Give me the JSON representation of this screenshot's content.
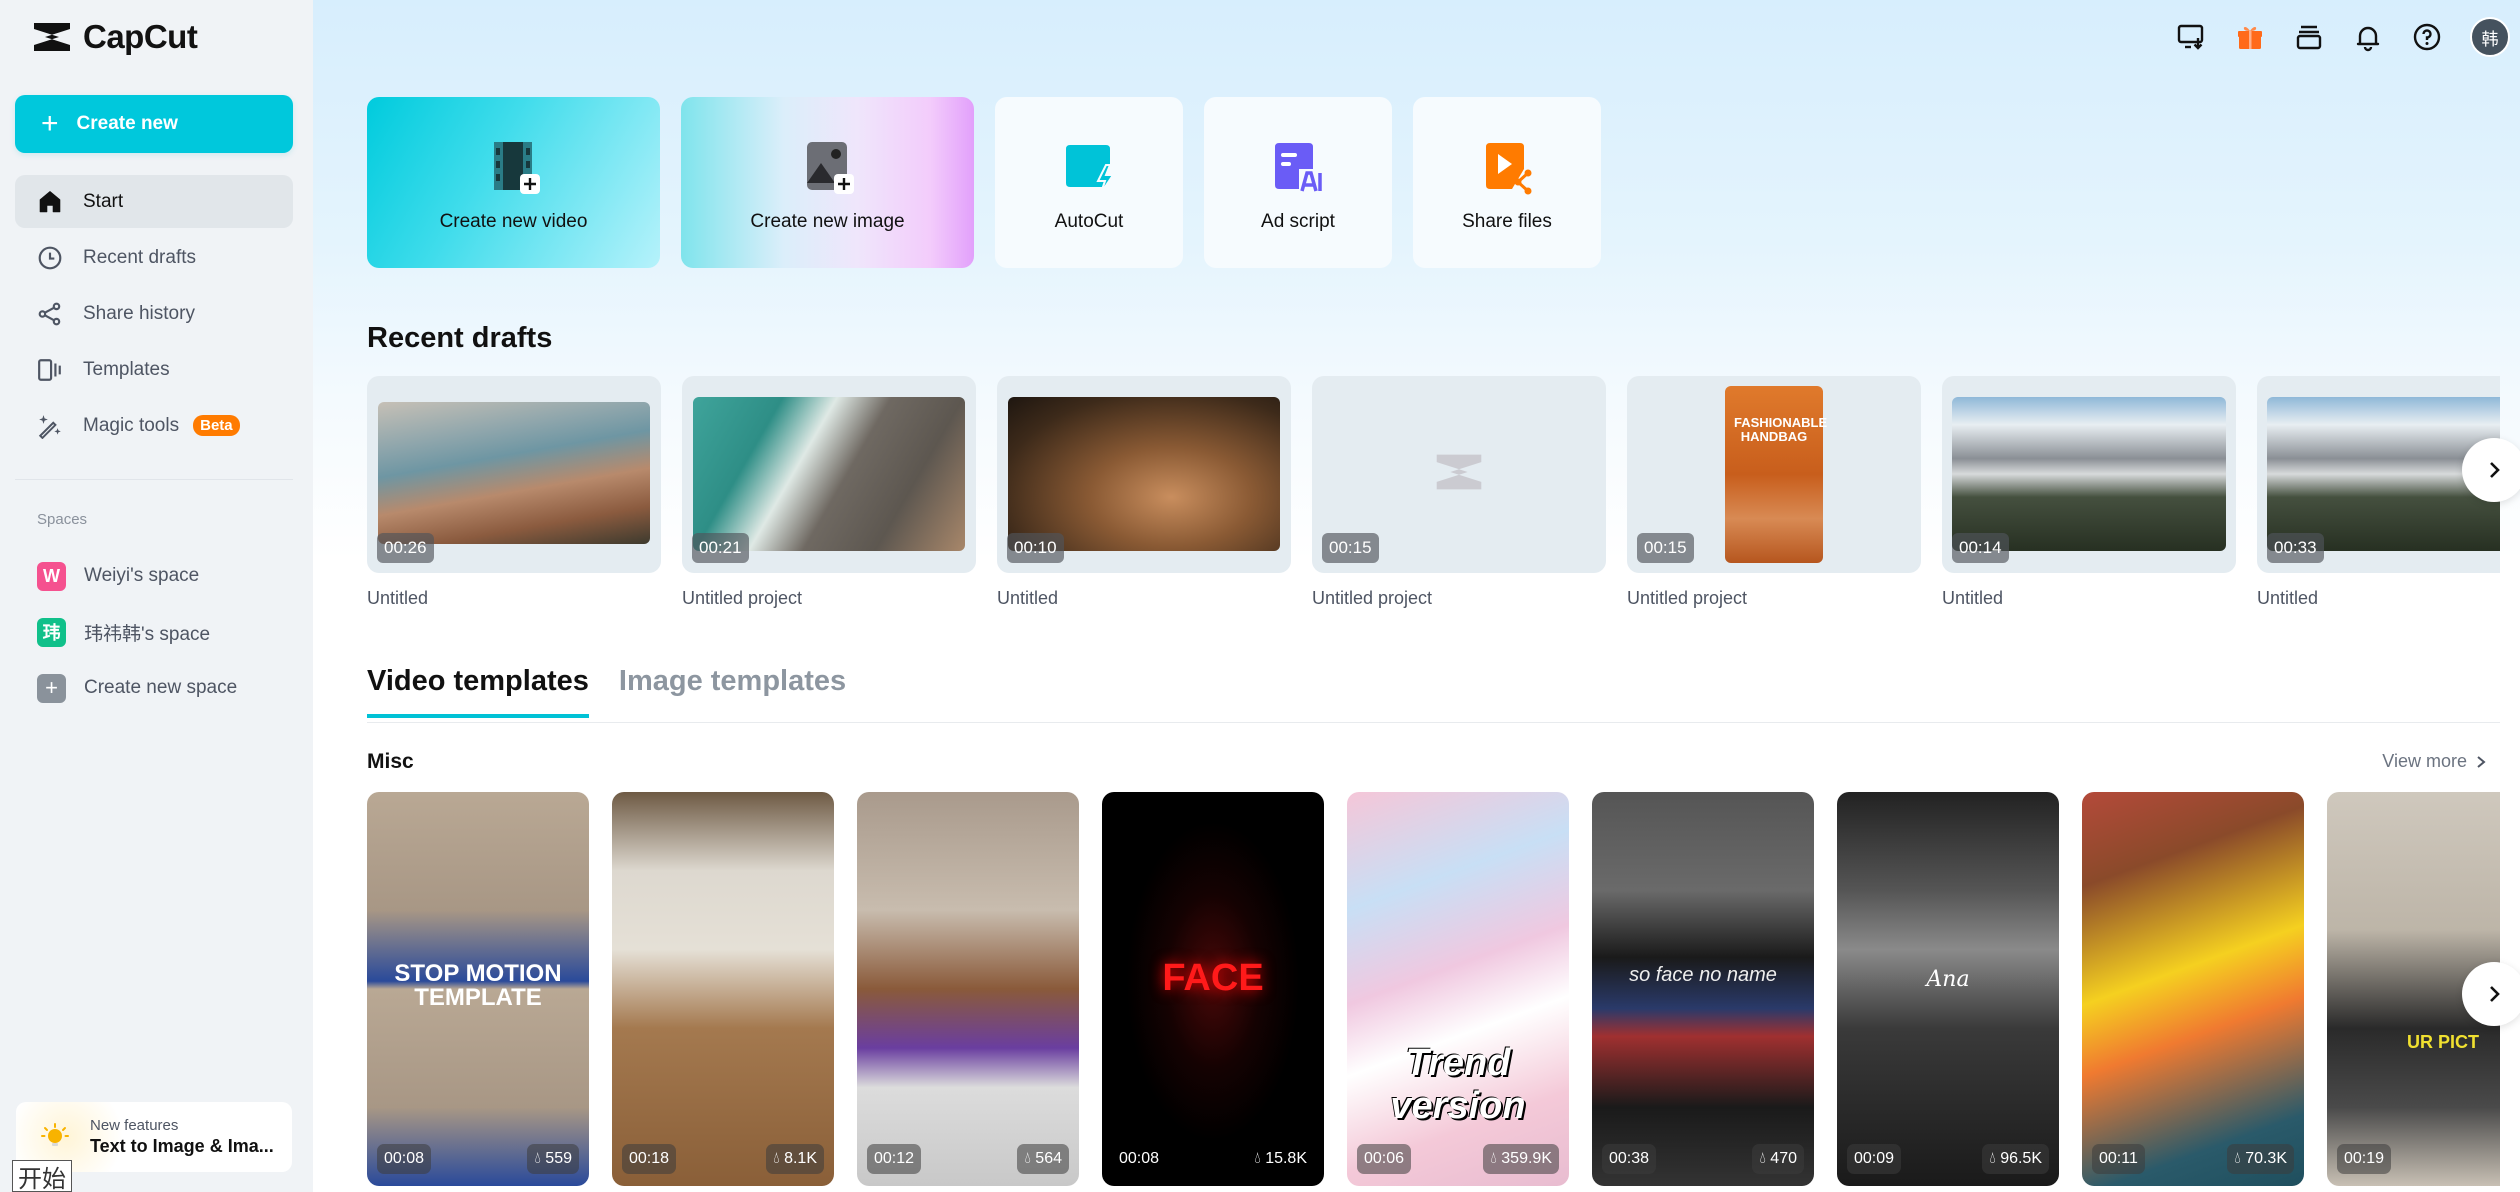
{
  "app": {
    "name": "CapCut"
  },
  "sidebar": {
    "create_label": "Create new",
    "nav": [
      {
        "label": "Start",
        "icon": "home-icon",
        "active": true
      },
      {
        "label": "Recent drafts",
        "icon": "clock-icon"
      },
      {
        "label": "Share history",
        "icon": "share-icon"
      },
      {
        "label": "Templates",
        "icon": "templates-icon"
      },
      {
        "label": "Magic tools",
        "icon": "magic-wand-icon",
        "badge": "Beta"
      }
    ],
    "spaces_label": "Spaces",
    "spaces": [
      {
        "badge": "W",
        "label": "Weiyi's space",
        "color": "#f5518f"
      },
      {
        "badge": "玮",
        "label": "玮祎韩's space",
        "color": "#10c08a"
      },
      {
        "badge": "+",
        "label": "Create new space",
        "color": "#8a929b"
      }
    ],
    "new_features": {
      "sub": "New features",
      "title": "Text to Image & Ima..."
    },
    "ime_indicator": "开始"
  },
  "topbar": {
    "icons": [
      "download-desktop-icon",
      "gift-icon",
      "inbox-icon",
      "bell-icon",
      "help-icon"
    ],
    "avatar": "韩"
  },
  "actions": [
    {
      "label": "Create new video",
      "icon": "film-plus-icon"
    },
    {
      "label": "Create new image",
      "icon": "image-plus-icon"
    },
    {
      "label": "AutoCut",
      "icon": "autocut-icon"
    },
    {
      "label": "Ad script",
      "icon": "ad-script-ai-icon"
    },
    {
      "label": "Share files",
      "icon": "share-files-icon"
    }
  ],
  "recent_drafts": {
    "title": "Recent drafts",
    "items": [
      {
        "name": "Untitled",
        "duration": "00:26",
        "thumb": "canyon-river"
      },
      {
        "name": "Untitled project",
        "duration": "00:21",
        "thumb": "ocean-waves"
      },
      {
        "name": "Untitled",
        "duration": "00:10",
        "thumb": "party-selfie"
      },
      {
        "name": "Untitled project",
        "duration": "00:15",
        "thumb": "empty"
      },
      {
        "name": "Untitled project",
        "duration": "00:15",
        "thumb": "fashionable-handbag",
        "overlay_text": "FASHIONABLE HANDBAG"
      },
      {
        "name": "Untitled",
        "duration": "00:14",
        "thumb": "mountains"
      },
      {
        "name": "Untitled",
        "duration": "00:33",
        "thumb": "mountains"
      }
    ]
  },
  "template_tabs": [
    {
      "label": "Video templates",
      "active": true
    },
    {
      "label": "Image templates"
    }
  ],
  "misc": {
    "title": "Misc",
    "view_more": "View more",
    "templates": [
      {
        "duration": "00:08",
        "uses": "559",
        "overlay": "STOP MOTION TEMPLATE"
      },
      {
        "duration": "00:18",
        "uses": "8.1K",
        "overlay": ""
      },
      {
        "duration": "00:12",
        "uses": "564",
        "overlay": ""
      },
      {
        "duration": "00:08",
        "uses": "15.8K",
        "overlay": "FACE"
      },
      {
        "duration": "00:06",
        "uses": "359.9K",
        "overlay": "Trend version"
      },
      {
        "duration": "00:38",
        "uses": "470",
        "overlay": "so face no name"
      },
      {
        "duration": "00:09",
        "uses": "96.5K",
        "overlay": "Ana"
      },
      {
        "duration": "00:11",
        "uses": "70.3K",
        "overlay": ""
      },
      {
        "duration": "00:19",
        "uses": "",
        "overlay": "UR PICT"
      }
    ]
  },
  "colors": {
    "accent": "#00c8dc",
    "beta": "#ff7b00",
    "gift": "#ff6a1a"
  }
}
